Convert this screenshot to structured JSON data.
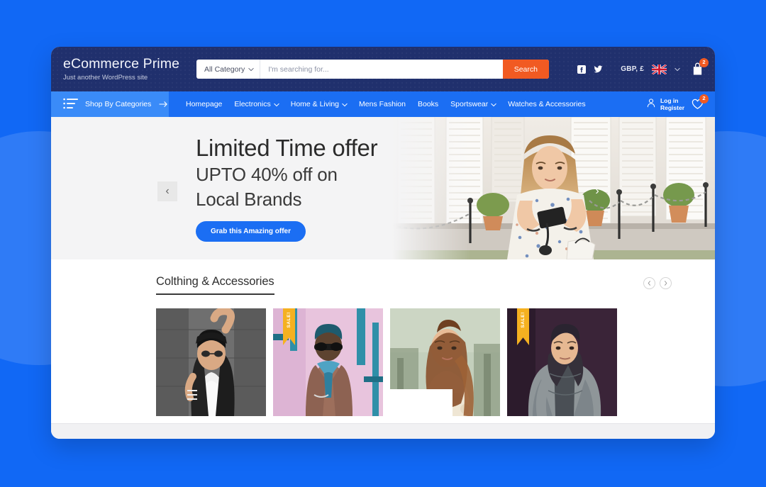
{
  "header": {
    "brand_title": "eCommerce Prime",
    "brand_tagline": "Just another WordPress site",
    "search": {
      "category_label": "All Category",
      "placeholder": "I'm searching for...",
      "value": "",
      "button_label": "Search"
    },
    "social": [
      {
        "name": "facebook-icon"
      },
      {
        "name": "twitter-icon"
      }
    ],
    "currency_label": "GBP, £",
    "flag": "uk-flag",
    "cart": {
      "icon": "cart-icon",
      "count": "2"
    }
  },
  "nav": {
    "shop_by_categories": "Shop By Categories",
    "menu": [
      {
        "label": "Homepage",
        "has_dropdown": false
      },
      {
        "label": "Electronics",
        "has_dropdown": true
      },
      {
        "label": "Home & Living",
        "has_dropdown": true
      },
      {
        "label": "Mens Fashion",
        "has_dropdown": false
      },
      {
        "label": "Books",
        "has_dropdown": false
      },
      {
        "label": "Sportswear",
        "has_dropdown": true
      },
      {
        "label": "Watches & Accessories",
        "has_dropdown": false
      }
    ],
    "account": {
      "login": "Log in",
      "register": "Register"
    },
    "wishlist": {
      "icon": "heart-icon",
      "count": "2"
    }
  },
  "hero": {
    "headline": "Limited Time offer",
    "subline_1": "UPTO 40% off on",
    "subline_2": "Local Brands",
    "cta": "Grab this Amazing offer",
    "prev": "‹",
    "next": "›"
  },
  "products": {
    "section_title": "Colthing & Accessories",
    "prev": "‹",
    "next": "›",
    "sale_label": "SALE!",
    "items": [
      {
        "name": "product-1",
        "on_sale": false,
        "theme": "gray"
      },
      {
        "name": "product-2",
        "on_sale": true,
        "theme": "pink"
      },
      {
        "name": "product-3",
        "on_sale": false,
        "theme": "sage"
      },
      {
        "name": "product-4",
        "on_sale": true,
        "theme": "plum"
      }
    ]
  },
  "colors": {
    "page_background": "#1168f5",
    "header_navy": "#20306d",
    "nav_blue": "#1b6ef3",
    "accent_orange": "#f15a22",
    "sale_yellow": "#f5b120"
  }
}
